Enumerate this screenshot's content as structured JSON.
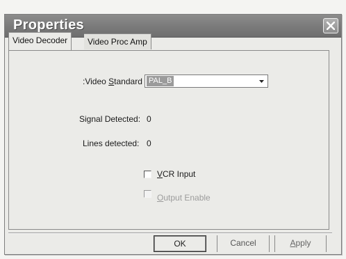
{
  "window": {
    "title": "Properties",
    "close_icon": "close-icon"
  },
  "tabs": [
    {
      "label": "Video Decoder",
      "active": true
    },
    {
      "label": "Video Proc Amp",
      "active": false
    }
  ],
  "video_decoder": {
    "video_standard_label_pre": ":Video ",
    "video_standard_label_mnemonic": "S",
    "video_standard_label_post": "tandard",
    "video_standard_value": "PAL_B",
    "signal_detected_label": "Signal Detected:",
    "signal_detected_value": "0",
    "lines_detected_label": "Lines detected:",
    "lines_detected_value": "0",
    "vcr_input_mnemonic": "V",
    "vcr_input_rest": "CR Input",
    "vcr_input_checked": false,
    "output_enable_mnemonic": "O",
    "output_enable_rest": "utput Enable",
    "output_enable_checked": false,
    "output_enable_disabled": true
  },
  "buttons": {
    "ok": "OK",
    "cancel": "Cancel",
    "apply_mnemonic": "A",
    "apply_rest": "pply"
  }
}
